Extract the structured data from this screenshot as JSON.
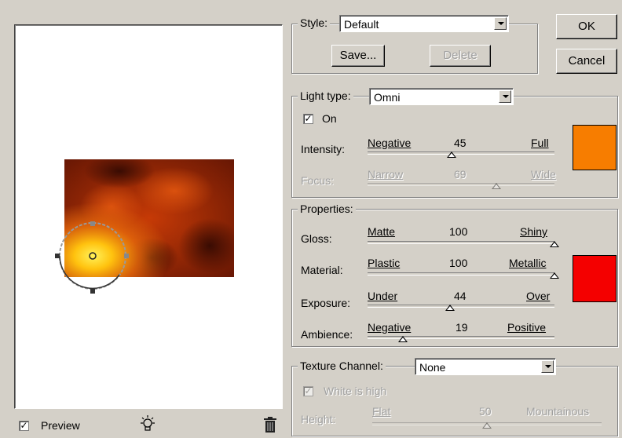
{
  "colors": {
    "light_swatch": "#f77d00",
    "material_swatch": "#f40000"
  },
  "style": {
    "label": "Style:",
    "value": "Default",
    "save_label": "Save...",
    "delete_label": "Delete"
  },
  "buttons": {
    "ok": "OK",
    "cancel": "Cancel"
  },
  "light": {
    "type_label": "Light type:",
    "type_value": "Omni",
    "on_label": "On",
    "on_check": "✓",
    "intensity": {
      "label": "Intensity:",
      "min": "Negative",
      "value": "45",
      "max": "Full",
      "level": 45
    },
    "focus": {
      "label": "Focus:",
      "min": "Narrow",
      "value": "69",
      "max": "Wide",
      "level": 69
    }
  },
  "properties": {
    "title": "Properties:",
    "gloss": {
      "label": "Gloss:",
      "min": "Matte",
      "value": "100",
      "max": "Shiny",
      "level": 100
    },
    "material": {
      "label": "Material:",
      "min": "Plastic",
      "value": "100",
      "max": "Metallic",
      "level": 100
    },
    "exposure": {
      "label": "Exposure:",
      "min": "Under",
      "value": "44",
      "max": "Over",
      "level": 44
    },
    "ambience": {
      "label": "Ambience:",
      "min": "Negative",
      "value": "19",
      "max": "Positive",
      "level": 19
    }
  },
  "texture": {
    "channel_label": "Texture Channel:",
    "channel_value": "None",
    "white_is_high": "White is high",
    "white_check": "✓",
    "height": {
      "label": "Height:",
      "min": "Flat",
      "value": "50",
      "max": "Mountainous",
      "level": 50
    }
  },
  "footer": {
    "preview_label": "Preview",
    "preview_check": "✓"
  }
}
